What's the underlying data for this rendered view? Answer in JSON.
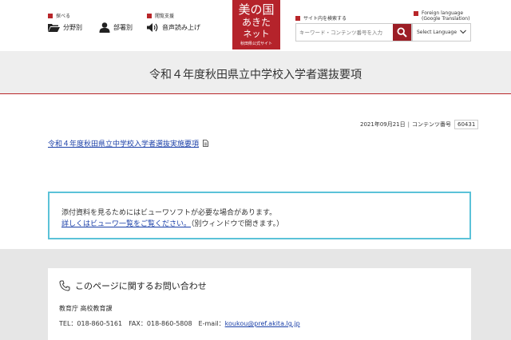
{
  "header": {
    "browse_caption": "探べる",
    "assist_caption": "閲覧支援",
    "by_field": "分野別",
    "by_department": "部署別",
    "read_aloud": "音声読み上げ",
    "logo": {
      "line1": "美の国",
      "line2": "あきた",
      "line3": "ネット",
      "line4": "秋田県公式サイト"
    },
    "search_caption": "サイト内を検索する",
    "search_placeholder": "キーワード・コンテンツ番号を入力",
    "lang_caption_1": "Foreign language",
    "lang_caption_2": "(Google Translation)",
    "lang_select": "Select Language"
  },
  "page": {
    "title": "令和４年度秋田県立中学校入学者選抜要項",
    "date": "2021年09月21日",
    "content_no_label": "コンテンツ番号",
    "content_no": "60431",
    "doc_link": "令和４年度秋田県立中学校入学者選抜実施要項"
  },
  "notice": {
    "line1": "添付資料を見るためにはビューワソフトが必要な場合があります。",
    "link": "詳しくはビューワ一覧をご覧ください。",
    "suffix": "（別ウィンドウで開きます。）"
  },
  "contact": {
    "title": "このページに関するお問い合わせ",
    "org": "教育庁 高校教育課",
    "tel": "TEL：018-860-5161　FAX：018-860-5808　E-mail：",
    "email": "koukou@pref.akita.lg.jp"
  },
  "colors": {
    "accent": "#b5232b",
    "link": "#1a3fa8",
    "notice_border": "#5bc2d8"
  }
}
